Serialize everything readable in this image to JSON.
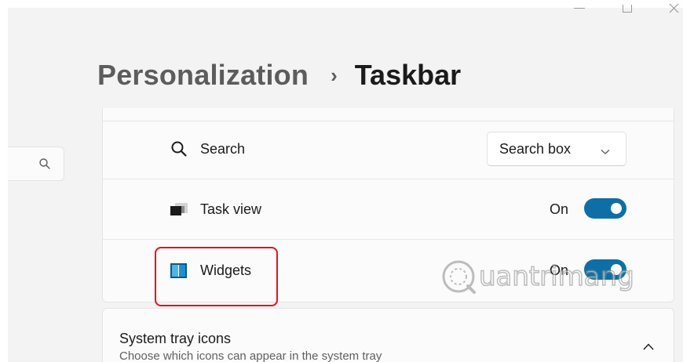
{
  "window": {
    "controls": [
      "minimize-icon",
      "maximize-icon",
      "close-icon"
    ]
  },
  "header": {
    "parent": "Personalization",
    "separator": "›",
    "current": "Taskbar"
  },
  "sidebar": {
    "search_icon": "search-icon"
  },
  "taskbar_items": {
    "search": {
      "label": "Search",
      "icon": "search-icon",
      "dropdown_value": "Search box"
    },
    "task_view": {
      "label": "Task view",
      "icon": "task-view-icon",
      "state": "On"
    },
    "widgets": {
      "label": "Widgets",
      "icon": "widgets-icon",
      "state": "On"
    }
  },
  "system_tray": {
    "title": "System tray icons",
    "subtitle": "Choose which icons can appear in the system tray"
  },
  "watermark": {
    "text": "uantrimang"
  },
  "colors": {
    "accent": "#0e6fa6",
    "highlight": "#e1141e",
    "app_background": "#f3f3f3",
    "card_background": "#fbfbfb"
  }
}
